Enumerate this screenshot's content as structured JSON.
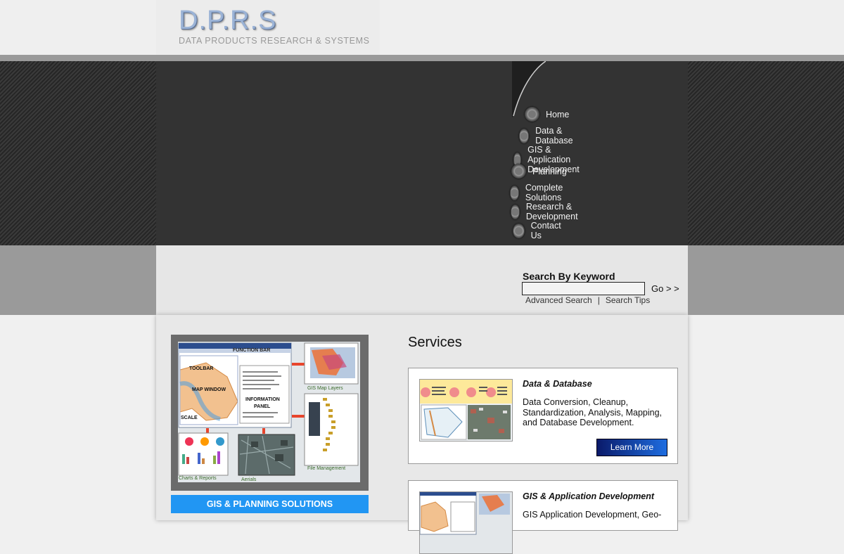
{
  "header": {
    "logo_text": "D.P.R.S",
    "tagline": "DATA PRODUCTS RESEARCH & SYSTEMS"
  },
  "nav": {
    "items": [
      {
        "label": "Home"
      },
      {
        "label": "Data & Database"
      },
      {
        "label": "GIS & Application Development"
      },
      {
        "label": "Planning"
      },
      {
        "label": "Complete Solutions"
      },
      {
        "label": "Research & Development"
      },
      {
        "label": "Contact Us"
      }
    ]
  },
  "search": {
    "title": "Search By Keyword",
    "input_value": "",
    "go_label": "Go > >",
    "advanced_label": "Advanced Search",
    "separator": "|",
    "tips_label": "Search Tips"
  },
  "promo": {
    "labels": {
      "function_bar": "FUNCTION BAR",
      "toolbar": "TOOLBAR",
      "map_window": "MAP WINDOW",
      "information": "INFORMATION",
      "panel": "PANEL",
      "scale": "SCALE",
      "gis_map_layers": "GIS Map Layers",
      "charts_reports": "Charts & Reports",
      "aerials": "Aerials",
      "file_management": "File Management"
    },
    "button_label": "GIS & PLANNING SOLUTIONS"
  },
  "services": {
    "title": "Services",
    "cards": [
      {
        "title": "Data & Database",
        "description": "Data Conversion, Cleanup, Standardization, Analysis, Mapping, and Database Development.",
        "button_label": "Learn More"
      },
      {
        "title": "GIS & Application Development",
        "description": "GIS Application Development, Geo-"
      }
    ]
  },
  "colors": {
    "promo_button": "#2196f3",
    "learn_more_start": "#0a1a6a",
    "learn_more_end": "#1e6de0"
  }
}
